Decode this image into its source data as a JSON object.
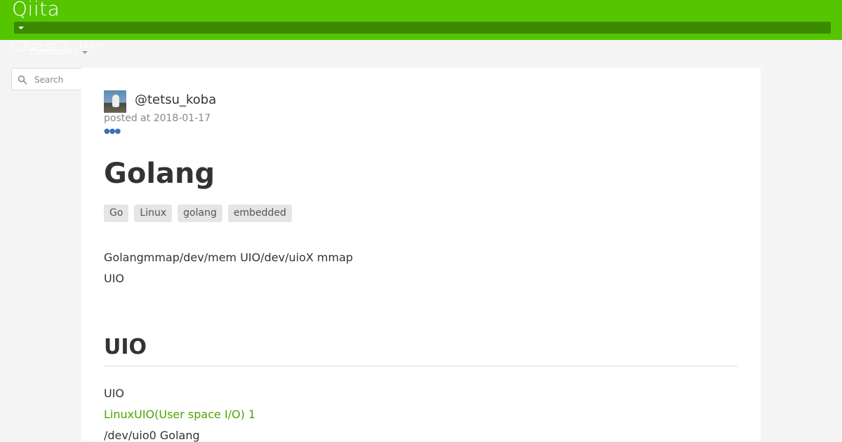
{
  "header": {
    "logo": "Qiita",
    "signup_label": "Sign up",
    "login_label": "Log in",
    "community_label": "Community"
  },
  "search": {
    "placeholder": "Search"
  },
  "article": {
    "author": "@tetsu_koba",
    "posted": "posted at 2018-01-17",
    "title": "Golang",
    "tags": [
      "Go",
      "Linux",
      "golang",
      "embedded"
    ],
    "intro": [
      "Golangmmap/dev/mem UIO/dev/uioX mmap",
      "UIO"
    ],
    "section_heading": "UIO",
    "section_text": [
      "UIO",
      "LinuxUIO(User space I/O) 1",
      "/dev/uio0 Golang"
    ]
  },
  "colors": {
    "header_bg": "#55c500",
    "link": "#4ea400",
    "page_bg": "#f4f4f4"
  },
  "icons": {
    "search": "search-icon",
    "more": "more-dots-icon"
  }
}
